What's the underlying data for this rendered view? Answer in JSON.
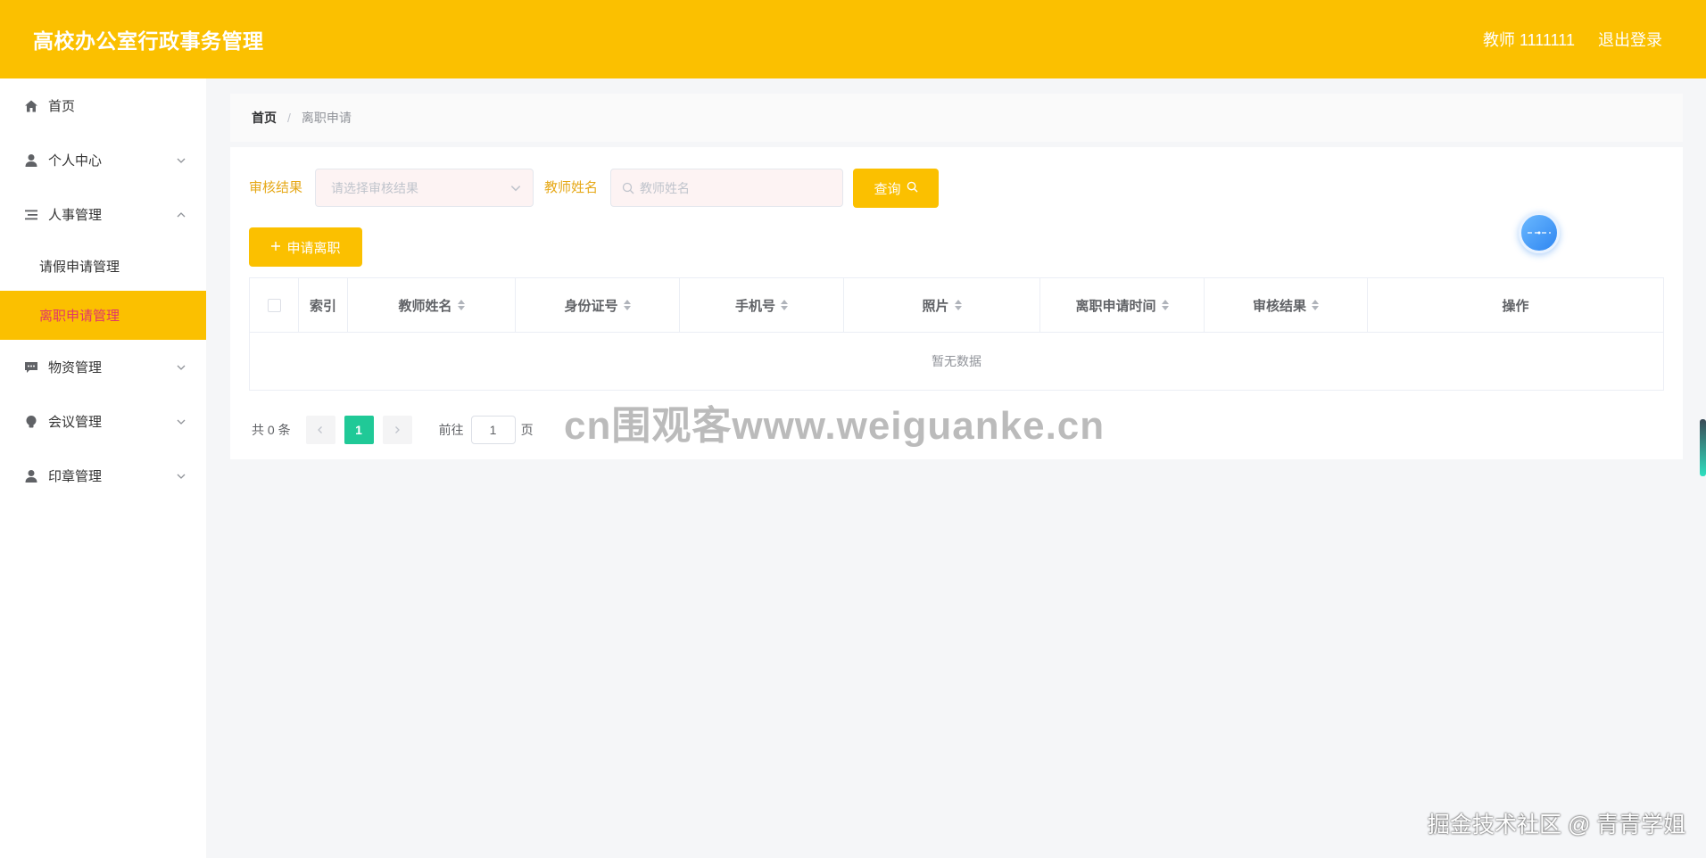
{
  "header": {
    "title": "高校办公室行政事务管理",
    "user": "教师 1111111",
    "logout": "退出登录"
  },
  "sidebar": {
    "items": [
      {
        "label": "首页",
        "icon": "home-icon"
      },
      {
        "label": "个人中心",
        "icon": "user-icon",
        "expanded": false
      },
      {
        "label": "人事管理",
        "icon": "list-icon",
        "expanded": true
      },
      {
        "label": "物资管理",
        "icon": "chat-icon",
        "expanded": false
      },
      {
        "label": "会议管理",
        "icon": "bulb-icon",
        "expanded": false
      },
      {
        "label": "印章管理",
        "icon": "stamp-user-icon",
        "expanded": false
      }
    ],
    "subitems": [
      {
        "label": "请假申请管理",
        "active": false
      },
      {
        "label": "离职申请管理",
        "active": true
      }
    ]
  },
  "breadcrumb": {
    "home": "首页",
    "separator": "/",
    "current": "离职申请"
  },
  "filters": {
    "review_label": "审核结果",
    "review_placeholder": "请选择审核结果",
    "teacher_label": "教师姓名",
    "teacher_placeholder": "教师姓名",
    "query_button": "查询"
  },
  "actions": {
    "apply_button": "申请离职"
  },
  "table": {
    "columns": [
      "索引",
      "教师姓名",
      "身份证号",
      "手机号",
      "照片",
      "离职申请时间",
      "审核结果",
      "操作"
    ],
    "empty_text": "暂无数据"
  },
  "pagination": {
    "total": "共 0 条",
    "current_page": "1",
    "goto_label": "前往",
    "goto_value": "1",
    "page_suffix": "页"
  },
  "watermarks": {
    "center": "cn围观客www.weiguanke.cn",
    "corner": "掘金技术社区 @ 青青学姐"
  },
  "colors": {
    "accent": "#fbc000",
    "active_page": "#20c997",
    "active_menu_text": "#e0356b"
  }
}
